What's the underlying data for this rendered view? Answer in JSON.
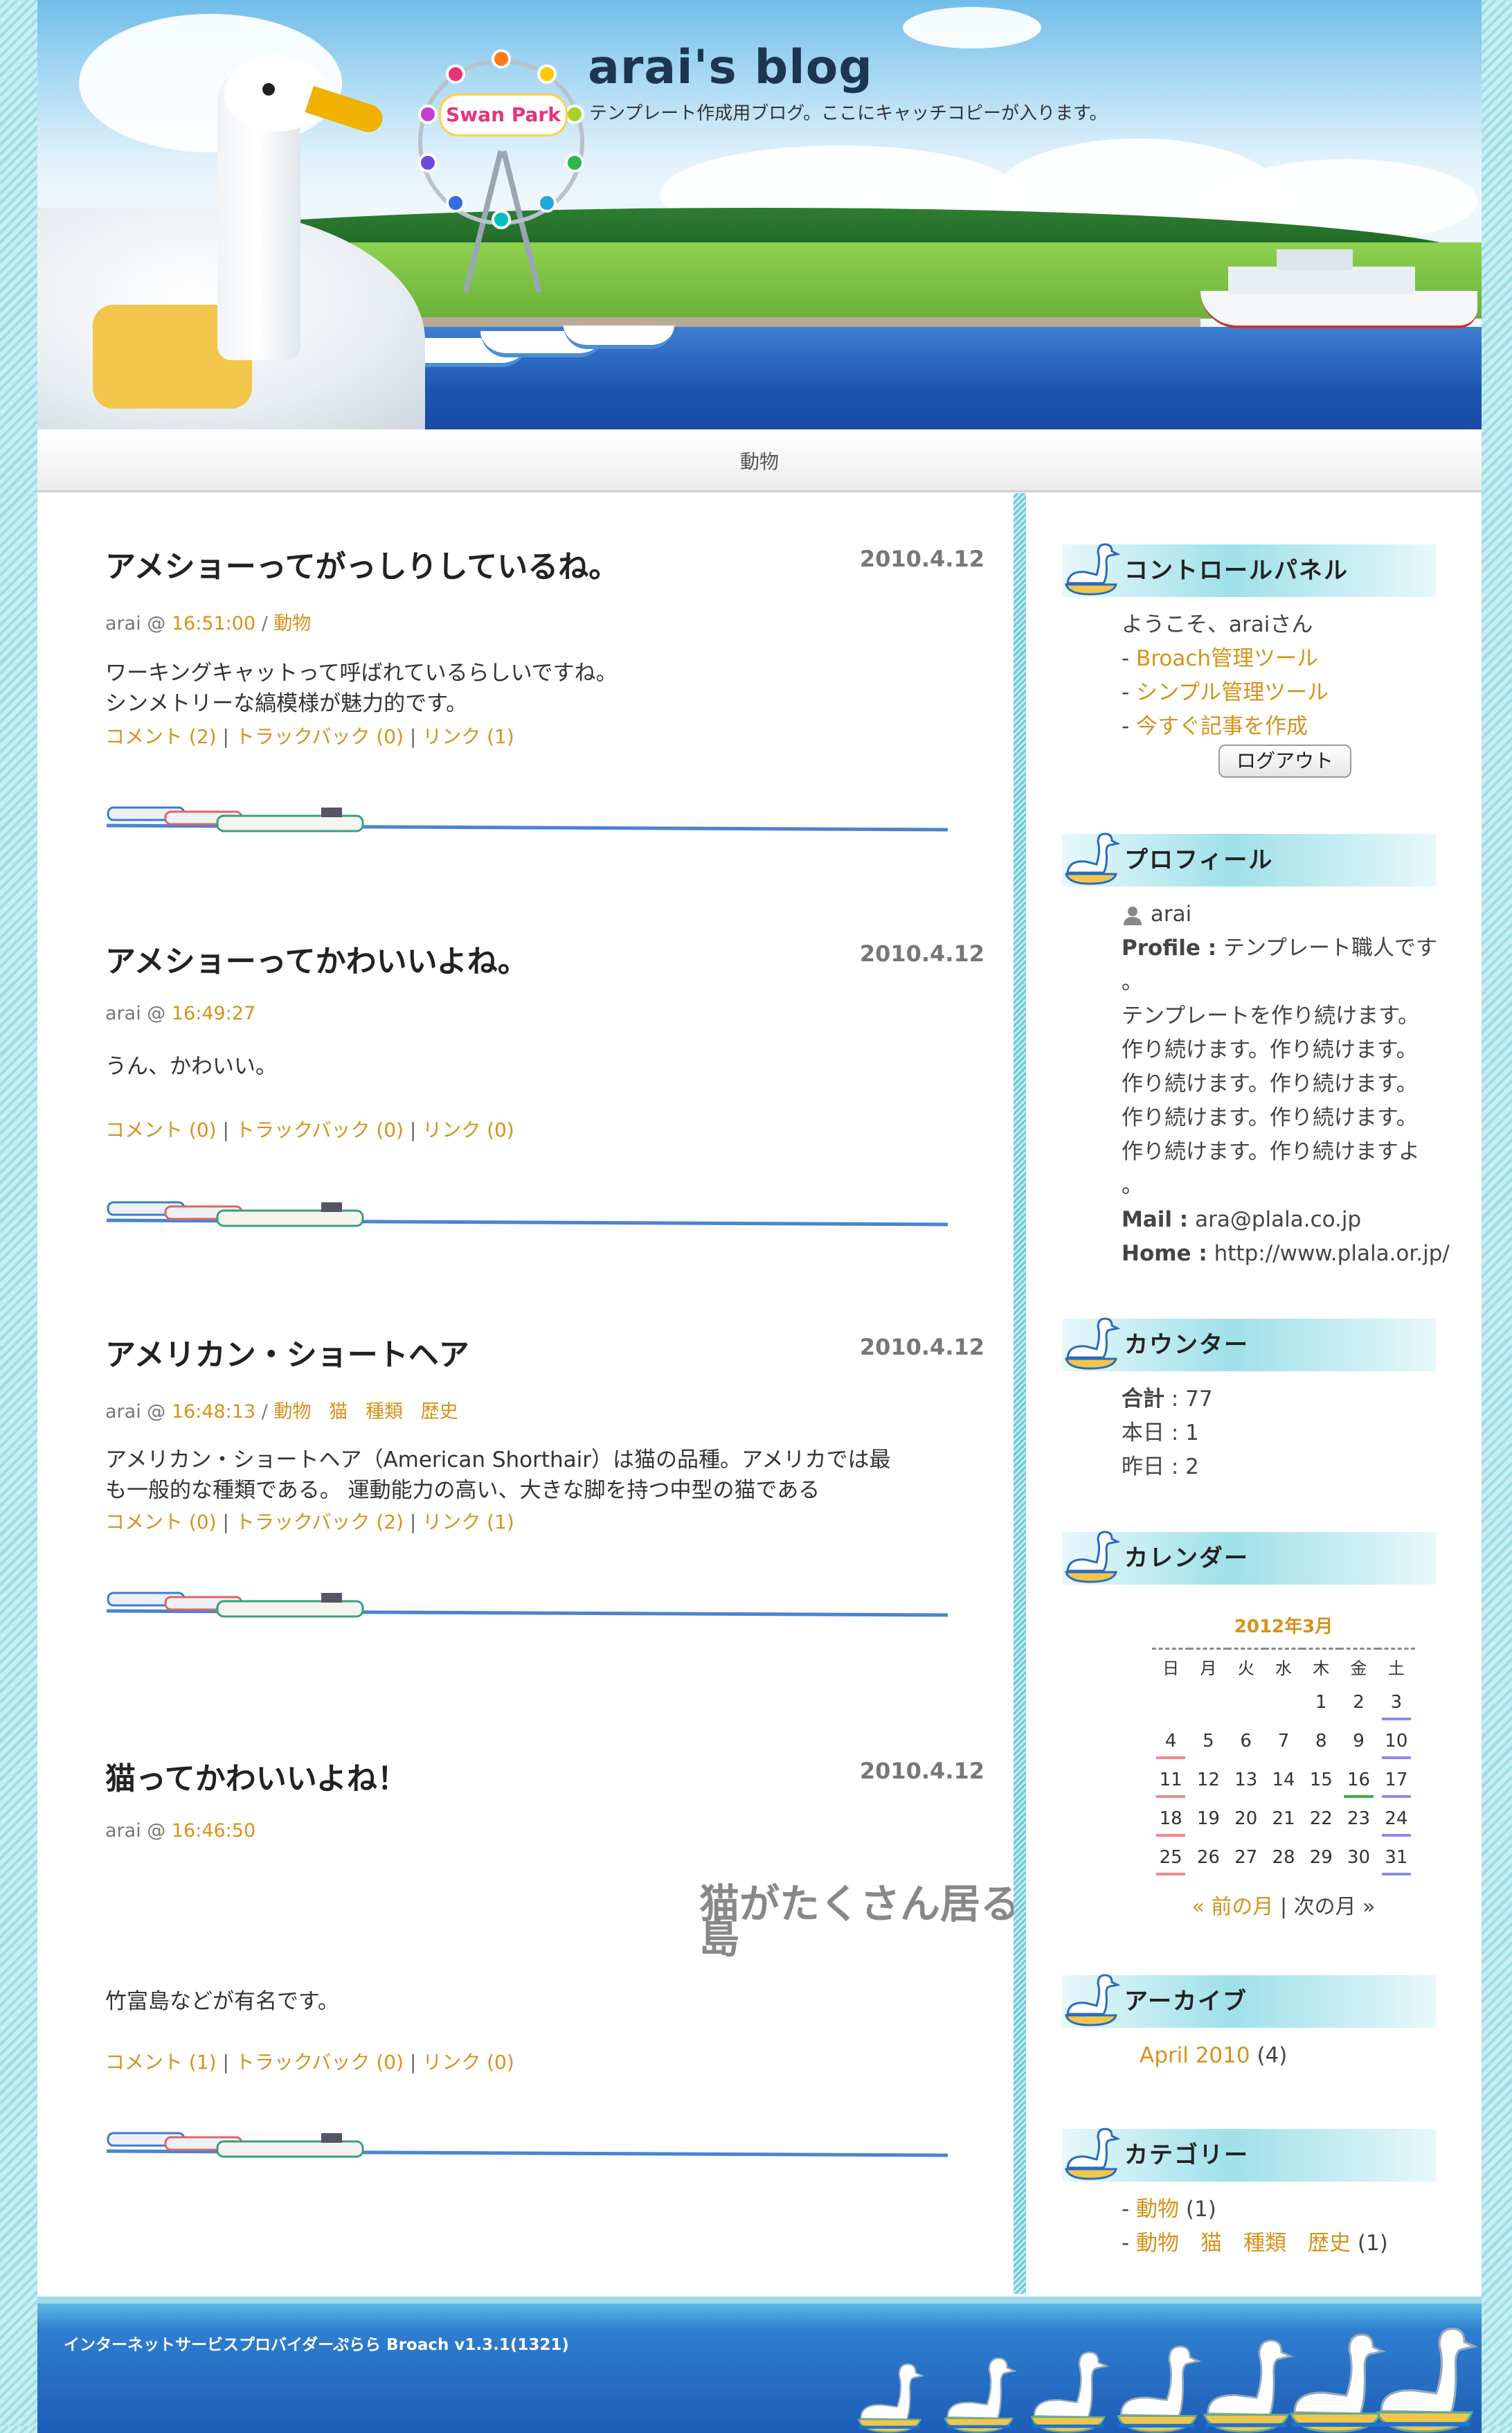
{
  "header": {
    "title": "arai's blog",
    "tagline": "テンプレート作成用ブログ。ここにキャッチコピーが入ります。",
    "ferris_wheel_sign": "Swan Park"
  },
  "nav": {
    "current_category": "動物"
  },
  "entries": [
    {
      "title": "アメショーってがっしりしているね。",
      "date": "2010.4.12",
      "author": "arai",
      "time": "16:51:00",
      "categories": [
        "動物"
      ],
      "body": [
        "ワーキングキャットって呼ばれているらしいですね。",
        "シンメトリーな縞模様が魅力的です。"
      ],
      "comments": "コメント (2)",
      "trackbacks": "トラックバック (0)",
      "links": "リンク (1)"
    },
    {
      "title": "アメショーってかわいいよね。",
      "date": "2010.4.12",
      "author": "arai",
      "time": "16:49:27",
      "categories": [],
      "body": [
        "うん、かわいい。"
      ],
      "comments": "コメント (0)",
      "trackbacks": "トラックバック (0)",
      "links": "リンク (0)"
    },
    {
      "title": "アメリカン・ショートヘア",
      "date": "2010.4.12",
      "author": "arai",
      "time": "16:48:13",
      "categories": [
        "動物",
        "猫",
        "種類",
        "歴史"
      ],
      "body": [
        "アメリカン・ショートヘア（American Shorthair）は猫の品種。アメリカでは最",
        "も一般的な種類である。 運動能力の高い、大きな脚を持つ中型の猫である"
      ],
      "comments": "コメント (0)",
      "trackbacks": "トラックバック (2)",
      "links": "リンク (1)"
    },
    {
      "title": "猫ってかわいいよね！",
      "date": "2010.4.12",
      "author": "arai",
      "time": "16:46:50",
      "categories": [],
      "overlay": "猫がたくさん居る島",
      "body": [
        "竹富島などが有名です。"
      ],
      "comments": "コメント (1)",
      "trackbacks": "トラックバック (0)",
      "links": "リンク (0)"
    }
  ],
  "sidebar": {
    "control_panel": {
      "title": "コントロールパネル",
      "welcome": "ようこそ、araiさん",
      "links": [
        "Broach管理ツール",
        "シンプル管理ツール",
        "今すぐ記事を作成"
      ],
      "logout": "ログアウト"
    },
    "profile": {
      "title": "プロフィール",
      "name": "arai",
      "profile_label": "Profile :",
      "profile_text": "テンプレート職人です",
      "profile_cont": "。",
      "lines": [
        "テンプレートを作り続けます。",
        "作り続けます。作り続けます。",
        "作り続けます。作り続けます。",
        "作り続けます。作り続けます。",
        "作り続けます。作り続けますよ",
        "。"
      ],
      "mail_label": "Mail :",
      "mail": "ara@plala.co.jp",
      "home_label": "Home :",
      "home": "http://www.plala.or.jp/"
    },
    "counter": {
      "title": "カウンター",
      "total_label": "合計",
      "total": "77",
      "today_label": "本日",
      "today": "1",
      "yesterday_label": "昨日",
      "yesterday": "2"
    },
    "calendar": {
      "title": "カレンダー",
      "month": "2012年3月",
      "weekdays": [
        "日",
        "月",
        "火",
        "水",
        "木",
        "金",
        "土"
      ],
      "weeks": [
        [
          "",
          "",
          "",
          "",
          "1",
          "2",
          "3"
        ],
        [
          "4",
          "5",
          "6",
          "7",
          "8",
          "9",
          "10"
        ],
        [
          "11",
          "12",
          "13",
          "14",
          "15",
          "16",
          "17"
        ],
        [
          "18",
          "19",
          "20",
          "21",
          "22",
          "23",
          "24"
        ],
        [
          "25",
          "26",
          "27",
          "28",
          "29",
          "30",
          "31"
        ]
      ],
      "holiday": "16",
      "prev": "« 前の月",
      "separator": "|",
      "next": "次の月 »"
    },
    "archive": {
      "title": "アーカイブ",
      "items": [
        {
          "label": "April 2010",
          "count": "(4)"
        }
      ]
    },
    "categories": {
      "title": "カテゴリー",
      "items": [
        {
          "label": "動物",
          "count": "(1)"
        },
        {
          "label": "動物　猫　種類　歴史",
          "count": "(1)"
        }
      ]
    }
  },
  "footer": {
    "text": "インターネットサービスプロバイダーぷらら Broach v1.3.1(1321)"
  },
  "colors": {
    "link": "#d6921b",
    "accent": "#6cc9d8",
    "title_bar": "#9fe0e9",
    "footer": "#1d5db8"
  }
}
